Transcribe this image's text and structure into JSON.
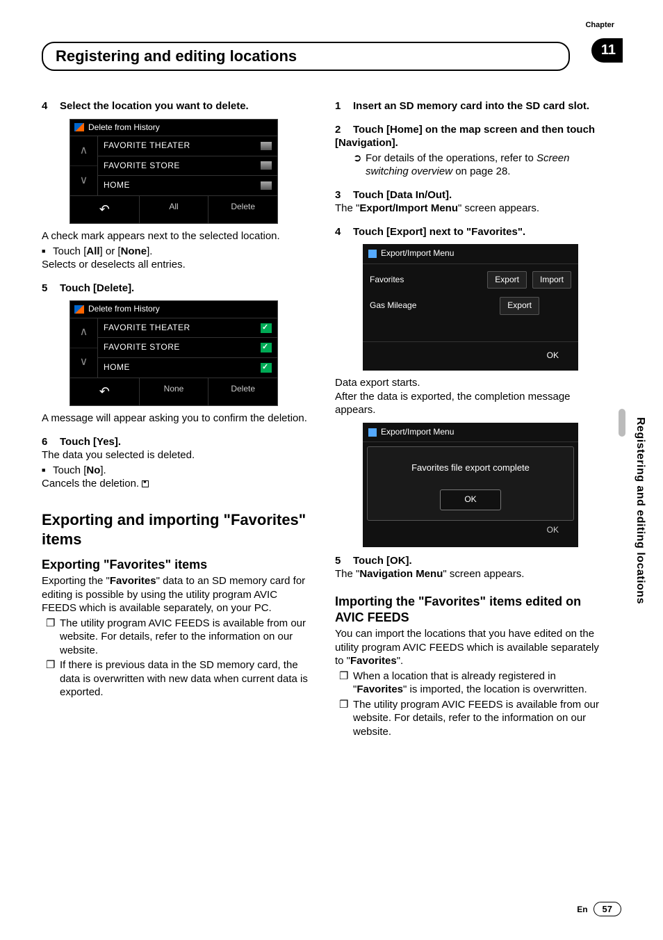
{
  "chapter": {
    "label": "Chapter",
    "number": "11",
    "title": "Registering and editing locations"
  },
  "side_label": "Registering and editing locations",
  "page": {
    "lang": "En",
    "num": "57"
  },
  "left": {
    "step4_head": "Select the location you want to delete.",
    "shot1": {
      "title": "Delete from History",
      "items": [
        "FAVORITE THEATER",
        "FAVORITE STORE",
        "HOME"
      ],
      "footer_mid": "All",
      "footer_right": "Delete"
    },
    "p_checkmark": "A check mark appears next to the selected location.",
    "bullet_all_none_pre": "Touch [",
    "bullet_all": "All",
    "bullet_all_none_mid": "] or [",
    "bullet_none": "None",
    "bullet_all_none_post": "].",
    "p_selects": "Selects or deselects all entries.",
    "step5_head": "Touch [Delete].",
    "shot2": {
      "title": "Delete from History",
      "items": [
        "FAVORITE THEATER",
        "FAVORITE STORE",
        "HOME"
      ],
      "footer_mid": "None",
      "footer_right": "Delete"
    },
    "p_confirm": "A message will appear asking you to confirm the deletion.",
    "step6_head": "Touch [Yes].",
    "p_deleted": "The data you selected is deleted.",
    "bullet_no_pre": "Touch [",
    "bullet_no": "No",
    "bullet_no_post": "].",
    "p_cancel": "Cancels the deletion.",
    "h2": "Exporting and importing \"Favorites\" items",
    "h3": "Exporting \"Favorites\" items",
    "p_export_intro_1": "Exporting the \"",
    "p_export_intro_b": "Favorites",
    "p_export_intro_2": "\" data to an SD memory card for editing is possible by using the utility program AVIC FEEDS which is available separately, on your PC.",
    "note1": "The utility program AVIC FEEDS is available from our website. For details, refer to the information on our website.",
    "note2": "If there is previous data in the SD memory card, the data is overwritten with new data when current data is exported."
  },
  "right": {
    "step1_head": "Insert an SD memory card into the SD card slot.",
    "step2_head": "Touch [Home] on the map screen and then touch [Navigation].",
    "arrow_note_pre": "For details of the operations, refer to ",
    "arrow_note_it": "Screen switching overview",
    "arrow_note_post": " on page 28.",
    "step3_head": "Touch [Data In/Out].",
    "p3_1": "The \"",
    "p3_b": "Export/Import Menu",
    "p3_2": "\" screen appears.",
    "step4_head": "Touch [Export] next to \"Favorites\".",
    "shotA": {
      "title": "Export/Import Menu",
      "row1_label": "Favorites",
      "row1_b1": "Export",
      "row1_b2": "Import",
      "row2_label": "Gas Mileage",
      "row2_b1": "Export",
      "footer": "OK"
    },
    "p_export_start": "Data export starts.",
    "p_export_done": "After the data is exported, the completion message appears.",
    "shotB": {
      "title": "Export/Import Menu",
      "msg": "Favorites file export complete",
      "ok": "OK",
      "footer_ok": "OK"
    },
    "step5_head": "Touch [OK].",
    "p5_1": "The \"",
    "p5_b": "Navigation Menu",
    "p5_2": "\" screen appears.",
    "h3": "Importing the \"Favorites\" items edited on AVIC FEEDS",
    "p_import_1": "You can import the locations that you have edited on the utility program AVIC FEEDS which is available separately to \"",
    "p_import_b": "Favorites",
    "p_import_2": "\".",
    "note1_1": "When a location that is already registered in \"",
    "note1_b": "Favorites",
    "note1_2": "\" is imported, the location is overwritten.",
    "note2": "The utility program AVIC FEEDS is available from our website. For details, refer to the information on our website."
  }
}
